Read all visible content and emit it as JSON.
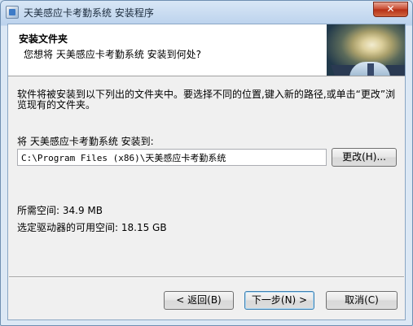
{
  "window": {
    "title": "天美感应卡考勤系统 安装程序",
    "close_label": "✕"
  },
  "header": {
    "title": "安装文件夹",
    "subtitle": "您想将 天美感应卡考勤系统 安装到何处?"
  },
  "body": {
    "description": "软件将被安装到以下列出的文件夹中。要选择不同的位置,键入新的路径,或单击“更改”浏览现有的文件夹。",
    "install_to_label": "将 天美感应卡考勤系统 安装到:",
    "install_path": "C:\\Program Files (x86)\\天美感应卡考勤系统",
    "browse_button": "更改(H)...",
    "space_required": "所需空间: 34.9 MB",
    "space_available": "选定驱动器的可用空间: 18.15 GB"
  },
  "footer": {
    "back_button": "< 返回(B)",
    "next_button": "下一步(N) >",
    "cancel_button": "取消(C)"
  }
}
